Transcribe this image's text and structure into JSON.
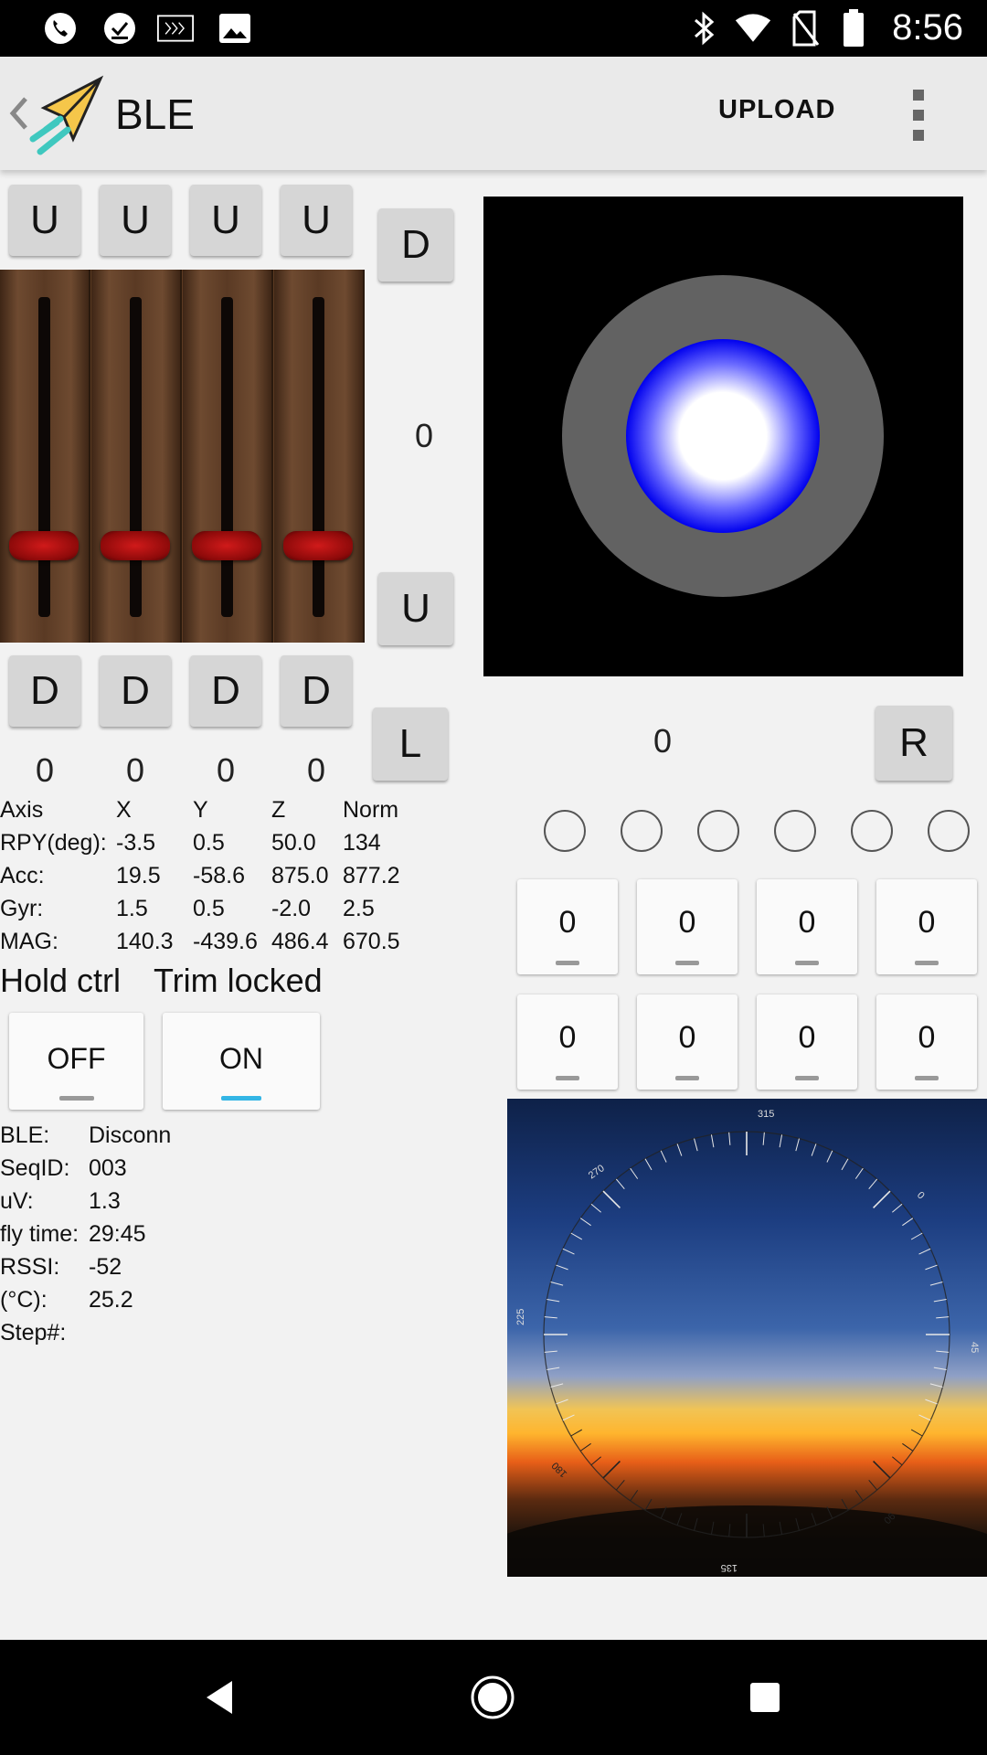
{
  "status_bar": {
    "time": "8:56",
    "left_icons": [
      "phone-clock-icon",
      "task-check-icon",
      "terminal-icon",
      "image-icon"
    ],
    "right_icons": [
      "bluetooth-icon",
      "wifi-icon",
      "no-sim-icon",
      "battery-icon"
    ]
  },
  "action_bar": {
    "title": "BLE",
    "upload_label": "UPLOAD"
  },
  "sliders": {
    "up_labels": [
      "U",
      "U",
      "U",
      "U"
    ],
    "down_labels": [
      "D",
      "D",
      "D",
      "D"
    ],
    "values": [
      "0",
      "0",
      "0",
      "0"
    ],
    "positions": [
      0.85,
      0.85,
      0.85,
      0.85
    ]
  },
  "side_controls": {
    "d_label": "D",
    "u_label": "U",
    "value": "0",
    "l_label": "L"
  },
  "joystick": {
    "value": "0",
    "r_label": "R"
  },
  "sensor_table": {
    "headers": [
      "Axis",
      "X",
      "Y",
      "Z",
      "Norm"
    ],
    "rows": [
      [
        "RPY(deg):",
        "-3.5",
        "0.5",
        "50.0",
        "134"
      ],
      [
        "Acc:",
        "19.5",
        "-58.6",
        "875.0",
        "877.2"
      ],
      [
        "Gyr:",
        "1.5",
        "0.5",
        "-2.0",
        "2.5"
      ],
      [
        "MAG:",
        "140.3",
        "-439.6",
        "486.4",
        "670.5"
      ]
    ]
  },
  "modes": {
    "hold_ctrl_label": "Hold ctrl",
    "trim_locked_label": "Trim locked",
    "off_label": "OFF",
    "on_label": "ON",
    "accent": "#33b5e5"
  },
  "status_info": {
    "rows": [
      {
        "label": "BLE:",
        "value": "Disconn"
      },
      {
        "label": "SeqID:",
        "value": "003"
      },
      {
        "label": "uV:",
        "value": "1.3"
      },
      {
        "label": "fly time:",
        "value": "29:45"
      },
      {
        "label": "RSSI:",
        "value": "-52"
      },
      {
        "label": "(°C):",
        "value": "25.2"
      },
      {
        "label": "Step#:",
        "value": ""
      }
    ]
  },
  "channel_indicators": 6,
  "number_boxes": {
    "row1": [
      "0",
      "0",
      "0",
      "0"
    ],
    "row2": [
      "0",
      "0",
      "0",
      "0"
    ]
  },
  "compass": {
    "labels": [
      "315",
      "270",
      "0",
      "225",
      "45",
      "180",
      "90",
      "135"
    ]
  },
  "nav_bar": {
    "icons": [
      "back-icon",
      "home-icon",
      "recents-icon"
    ]
  }
}
